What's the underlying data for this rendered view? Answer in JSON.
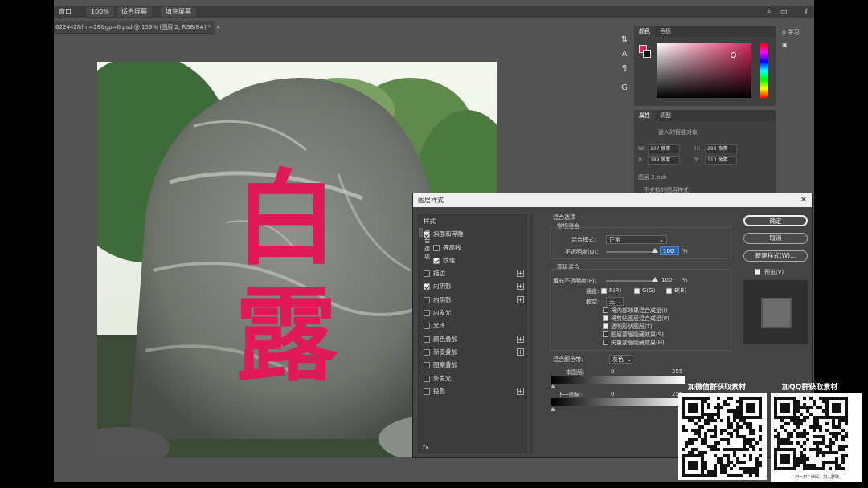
{
  "topbar": {
    "window_menu": "窗口",
    "zoom": "100%",
    "fit_screen": "适合屏幕",
    "fill_screen": "填充屏幕"
  },
  "document_tab": "622442&fm=26&gp=0.psd @ 159% (图层 2, RGB/8#) *",
  "color_panel": {
    "tab_color": "颜色",
    "tab_swatch": "色板",
    "foreground": "#d4245a"
  },
  "learn_label": "学习",
  "properties": {
    "tab_props": "属性",
    "tab_adjust": "调整",
    "smart_object": "嵌入的智能对象",
    "w_label": "W:",
    "w_val": "107 像素",
    "h_label": "H:",
    "h_val": "298 像素",
    "x_label": "X:",
    "x_val": "189 像素",
    "y_label": "Y:",
    "y_val": "110 像素",
    "file": "图层 2.psb",
    "extra": "不支持的图层样式"
  },
  "canvas": {
    "carving_text": "白露",
    "carving_color": "#e0195a"
  },
  "dialog": {
    "title": "图层样式",
    "list_header": "样式",
    "items": [
      {
        "label": "混合选项",
        "checked": null,
        "plus": false,
        "indent": false,
        "selected": true
      },
      {
        "label": "斜面和浮雕",
        "checked": true,
        "plus": false,
        "indent": false,
        "selected": false
      },
      {
        "label": "等高线",
        "checked": false,
        "plus": false,
        "indent": true,
        "selected": false
      },
      {
        "label": "纹理",
        "checked": true,
        "plus": false,
        "indent": true,
        "selected": false
      },
      {
        "label": "描边",
        "checked": false,
        "plus": true,
        "indent": false,
        "selected": false
      },
      {
        "label": "内阴影",
        "checked": true,
        "plus": true,
        "indent": false,
        "selected": false
      },
      {
        "label": "内阴影",
        "checked": false,
        "plus": true,
        "indent": false,
        "selected": false
      },
      {
        "label": "内发光",
        "checked": false,
        "plus": false,
        "indent": false,
        "selected": false
      },
      {
        "label": "光泽",
        "checked": false,
        "plus": false,
        "indent": false,
        "selected": false
      },
      {
        "label": "颜色叠加",
        "checked": false,
        "plus": true,
        "indent": false,
        "selected": false
      },
      {
        "label": "渐变叠加",
        "checked": false,
        "plus": true,
        "indent": false,
        "selected": false
      },
      {
        "label": "图案叠加",
        "checked": false,
        "plus": false,
        "indent": false,
        "selected": false
      },
      {
        "label": "外发光",
        "checked": false,
        "plus": false,
        "indent": false,
        "selected": false
      },
      {
        "label": "投影",
        "checked": false,
        "plus": true,
        "indent": false,
        "selected": false
      }
    ],
    "fx": "fx",
    "blend_options": "混合选项",
    "general_blend": "常规混合",
    "blend_mode_label": "混合模式:",
    "blend_mode": "正常",
    "opacity_label": "不透明度(O):",
    "opacity": "100",
    "pct": "%",
    "advanced_blend": "高级混合",
    "fill_opacity_label": "填充不透明度(F):",
    "fill_opacity": "100",
    "channels_label": "通道:",
    "ch_r": "R(R)",
    "ch_g": "G(G)",
    "ch_b": "B(B)",
    "knockout_label": "挖空:",
    "knockout": "无",
    "opts": [
      {
        "label": "将内部效果混合成组(I)",
        "checked": false
      },
      {
        "label": "将剪贴图层混合成组(P)",
        "checked": true
      },
      {
        "label": "透明形状图层(T)",
        "checked": true
      },
      {
        "label": "图层蒙版隐藏效果(S)",
        "checked": false
      },
      {
        "label": "矢量蒙版隐藏效果(H)",
        "checked": false
      }
    ],
    "blend_if_label": "混合颜色带:",
    "blend_if": "灰色",
    "this_layer": "本图层:",
    "under_layer": "下一图层:",
    "v0": "0",
    "v255": "255",
    "ok": "确定",
    "cancel": "取消",
    "new_style": "新建样式(W)...",
    "preview": "预览(V)"
  },
  "promo": {
    "wechat": "加微信群获取素材",
    "qq": "加QQ群获取素材",
    "scan": "扫一扫二维码，加入群聊。"
  }
}
